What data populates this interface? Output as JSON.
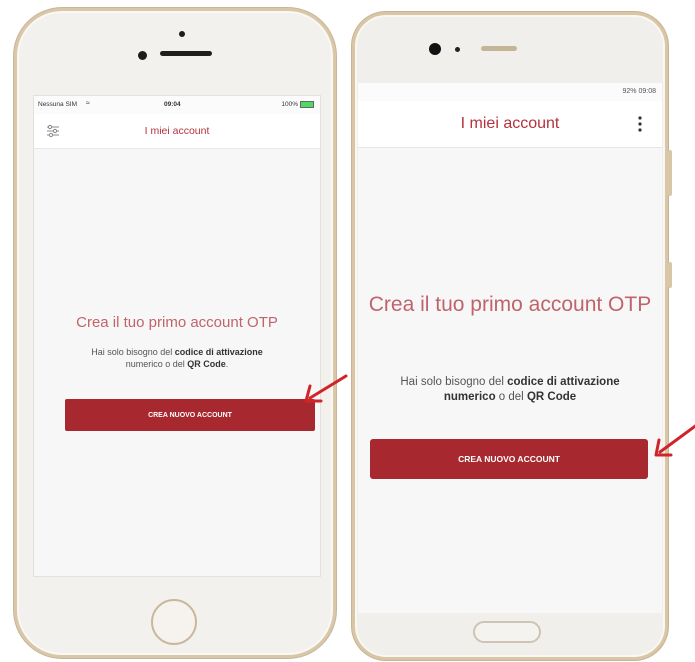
{
  "iphone": {
    "status": {
      "carrier": "Nessuna SIM",
      "time": "09:04",
      "battery": "100%"
    },
    "title": "I miei account",
    "headline": "Crea il tuo primo account OTP",
    "desc": {
      "part1": "Hai solo bisogno del ",
      "bold1": "codice di attivazione",
      "part2": " numerico o del ",
      "bold2": "QR Code",
      "part3": "."
    },
    "button_label": "CREA NUOVO ACCOUNT"
  },
  "android": {
    "status": {
      "right": "92% 09:08"
    },
    "title": "I miei account",
    "headline": "Crea il tuo primo account OTP",
    "desc": {
      "part1": "Hai solo bisogno del ",
      "bold1": "codice di attivazione numerico",
      "part2": " o del ",
      "bold2": "QR Code",
      "part3": ""
    },
    "button_label": "CREA NUOVO ACCOUNT"
  },
  "colors": {
    "accent": "#a8282f",
    "title": "#b3323c",
    "arrow": "#d0242b"
  },
  "icons": {
    "iphone_menu": "settings-sliders-icon",
    "android_menu": "more-vertical-icon"
  }
}
